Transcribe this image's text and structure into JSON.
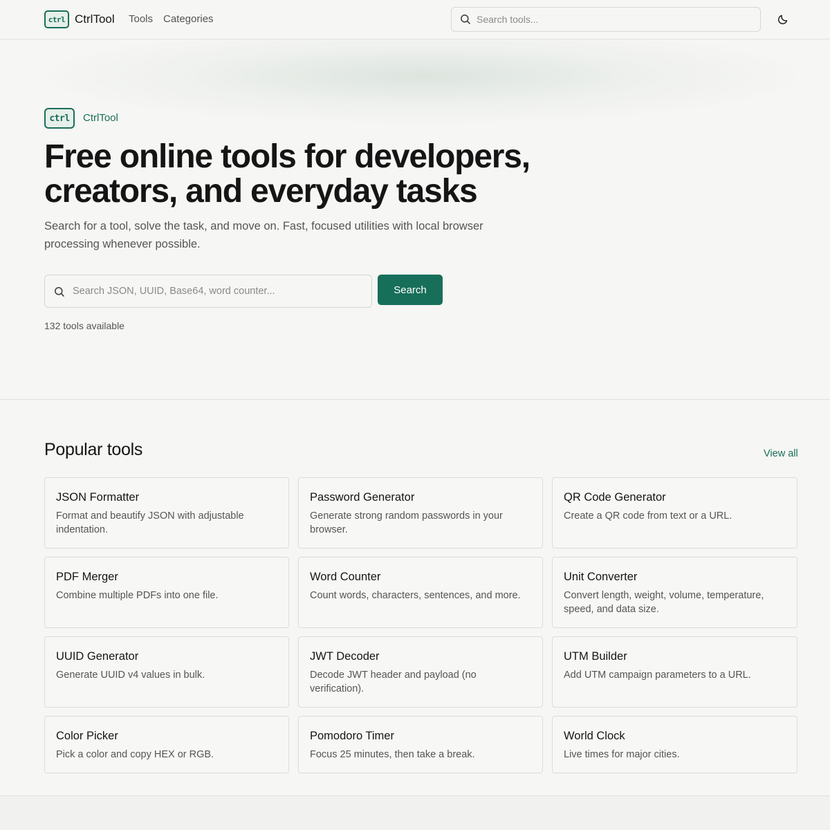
{
  "header": {
    "logo_text": "ctrl",
    "brand": "CtrlTool",
    "nav": [
      "Tools",
      "Categories"
    ],
    "search_placeholder": "Search tools..."
  },
  "hero": {
    "badge_logo_text": "ctrl",
    "badge_text": "CtrlTool",
    "title": "Free online tools for developers, creators, and everyday tasks",
    "subtitle": "Search for a tool, solve the task, and move on. Fast, focused utilities with local browser processing whenever possible.",
    "search_placeholder": "Search JSON, UUID, Base64, word counter...",
    "search_button": "Search",
    "tool_count": "132 tools available"
  },
  "popular": {
    "title": "Popular tools",
    "view_all": "View all",
    "tools": [
      {
        "name": "JSON Formatter",
        "desc": "Format and beautify JSON with adjustable indentation."
      },
      {
        "name": "Password Generator",
        "desc": "Generate strong random passwords in your browser."
      },
      {
        "name": "QR Code Generator",
        "desc": "Create a QR code from text or a URL."
      },
      {
        "name": "PDF Merger",
        "desc": "Combine multiple PDFs into one file."
      },
      {
        "name": "Word Counter",
        "desc": "Count words, characters, sentences, and more."
      },
      {
        "name": "Unit Converter",
        "desc": "Convert length, weight, volume, temperature, speed, and data size."
      },
      {
        "name": "UUID Generator",
        "desc": "Generate UUID v4 values in bulk."
      },
      {
        "name": "JWT Decoder",
        "desc": "Decode JWT header and payload (no verification)."
      },
      {
        "name": "UTM Builder",
        "desc": "Add UTM campaign parameters to a URL."
      },
      {
        "name": "Color Picker",
        "desc": "Pick a color and copy HEX or RGB."
      },
      {
        "name": "Pomodoro Timer",
        "desc": "Focus 25 minutes, then take a break."
      },
      {
        "name": "World Clock",
        "desc": "Live times for major cities."
      }
    ]
  },
  "colors": {
    "accent": "#176f59",
    "background": "#f6f6f4"
  },
  "icons": {
    "search": "search-icon",
    "theme": "moon-icon"
  }
}
